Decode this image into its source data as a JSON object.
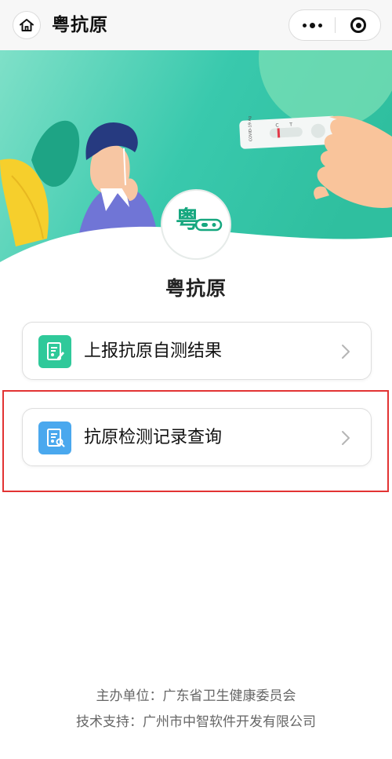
{
  "nav": {
    "title": "粤抗原",
    "home_icon": "home-icon",
    "more_icon": "more-dots-icon",
    "close_icon": "close-target-icon"
  },
  "banner": {
    "test_strip_text": "COVID-19 Ag",
    "test_strip_c": "C",
    "test_strip_t": "T",
    "logo_char": "粤"
  },
  "brand": {
    "name": "粤抗原"
  },
  "menu": [
    {
      "label": "上报抗原自测结果",
      "icon": "report-form-icon",
      "color": "#2fc99a"
    },
    {
      "label": "抗原检测记录查询",
      "icon": "record-search-icon",
      "color": "#4aa8ee"
    }
  ],
  "footer": {
    "sponsor": "主办单位：广东省卫生健康委员会",
    "support": "技术支持：广州市中智软件开发有限公司"
  },
  "colors": {
    "banner_teal": "#35c7ae",
    "banner_light": "#8fe3c8",
    "highlight": "#e23333"
  }
}
